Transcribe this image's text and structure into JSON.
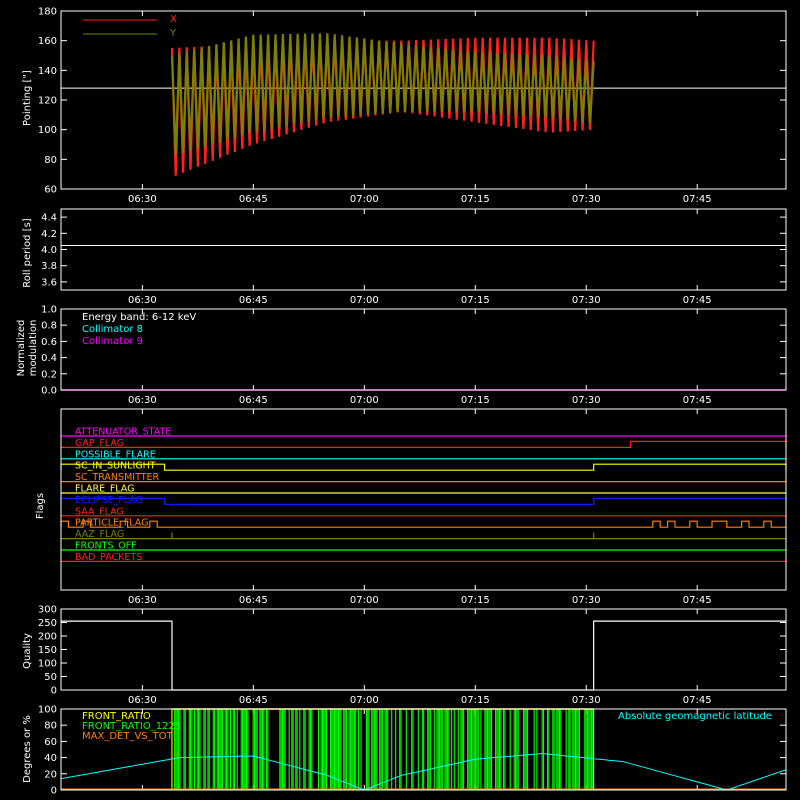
{
  "time_axis": {
    "start": "06:19",
    "end": "07:57",
    "tick_labels": [
      "06:30",
      "06:45",
      "07:00",
      "07:15",
      "07:30",
      "07:45"
    ]
  },
  "chart_data": [
    {
      "type": "line",
      "ylabel": "Pointing [\"]",
      "ylim": [
        60,
        180
      ],
      "yticks": [
        "60",
        "80",
        "100",
        "120",
        "140",
        "160",
        "180"
      ],
      "reference_line": 128,
      "series": [
        {
          "name": "X",
          "color": "#ff2020",
          "t": [
            "06:34",
            "06:45",
            "06:55",
            "07:05",
            "07:15",
            "07:25",
            "07:31"
          ],
          "high": [
            155,
            158,
            160,
            160,
            162,
            162,
            160
          ],
          "low": [
            68,
            90,
            105,
            112,
            105,
            98,
            100
          ]
        },
        {
          "name": "Y",
          "color": "#808000",
          "t": [
            "06:34",
            "06:45",
            "06:55",
            "07:05",
            "07:15",
            "07:25",
            "07:31"
          ],
          "high": [
            150,
            164,
            165,
            158,
            152,
            150,
            146
          ],
          "low": [
            82,
            98,
            108,
            112,
            112,
            108,
            104
          ]
        }
      ]
    },
    {
      "type": "line",
      "ylabel": "Roll period [s]",
      "ylim": [
        3.5,
        4.5
      ],
      "yticks": [
        "3.6",
        "3.8",
        "4.0",
        "4.2",
        "4.4"
      ],
      "series": [
        {
          "name": "",
          "color": "#ffffff",
          "value": 4.05
        }
      ]
    },
    {
      "type": "line",
      "ylabel": "Normalized modulation",
      "ylim": [
        0,
        1
      ],
      "yticks": [
        "0.0",
        "0.2",
        "0.4",
        "0.6",
        "0.8",
        "1.0"
      ],
      "annotations": [
        {
          "text": "Energy band: 6-12 keV",
          "color": "#ffffff"
        },
        {
          "text": "Collimator 8",
          "color": "#00ffff"
        },
        {
          "text": "Collimator 9",
          "color": "#ff00ff"
        }
      ],
      "series": [
        {
          "name": "Collimator 9",
          "color": "#ff00ff",
          "value": 0.0
        }
      ]
    },
    {
      "type": "line",
      "ylabel": "Flags",
      "flags": [
        {
          "name": "ATTENUATOR_STATE",
          "color": "#ff00ff",
          "segments": []
        },
        {
          "name": "GAP_FLAG",
          "color": "#ff2020",
          "segments": [
            [
              "07:36",
              "07:57"
            ]
          ]
        },
        {
          "name": "POSSIBLE_FLARE",
          "color": "#00ffff",
          "segments": []
        },
        {
          "name": "SC_IN_SUNLIGHT",
          "color": "#ffff00",
          "segments": [
            [
              "06:19",
              "06:33"
            ],
            [
              "07:31",
              "07:57"
            ]
          ]
        },
        {
          "name": "SC_TRANSMITTER",
          "color": "#ff8000",
          "segments": []
        },
        {
          "name": "FLARE_FLAG",
          "color": "#ffff40",
          "segments": []
        },
        {
          "name": "ECLIPSE_FLAG",
          "color": "#0020ff",
          "segments": [
            [
              "06:19",
              "06:33"
            ],
            [
              "07:31",
              "07:57"
            ]
          ]
        },
        {
          "name": "SAA_FLAG",
          "color": "#ff2020",
          "segments": []
        },
        {
          "name": "PARTICLE_FLAG",
          "color": "#ff8000",
          "segments": [
            [
              "06:19",
              "06:20"
            ],
            [
              "06:22",
              "06:23"
            ],
            [
              "06:27",
              "06:28"
            ],
            [
              "06:31",
              "06:32"
            ],
            [
              "07:39",
              "07:40"
            ],
            [
              "07:41",
              "07:42"
            ],
            [
              "07:44",
              "07:45"
            ],
            [
              "07:47",
              "07:49"
            ],
            [
              "07:51",
              "07:52"
            ],
            [
              "07:54",
              "07:55"
            ]
          ]
        },
        {
          "name": "AAZ_FLAG",
          "color": "#808000",
          "segments": [
            [
              "06:34",
              "06:34"
            ],
            [
              "07:31",
              "07:31"
            ]
          ]
        },
        {
          "name": "FRONTS_OFF",
          "color": "#00ff00",
          "segments": []
        },
        {
          "name": "BAD_PACKETS",
          "color": "#ff2020",
          "segments": []
        }
      ]
    },
    {
      "type": "line",
      "ylabel": "Quality",
      "ylim": [
        0,
        300
      ],
      "yticks": [
        "0",
        "50",
        "100",
        "150",
        "200",
        "250",
        "300"
      ],
      "series": [
        {
          "name": "",
          "color": "#ffffff",
          "value_high": 255,
          "value_low": 0,
          "high_segments": [
            [
              "06:19",
              "06:34"
            ],
            [
              "07:31",
              "07:57"
            ]
          ]
        }
      ]
    },
    {
      "type": "line",
      "ylabel": "Degrees or %",
      "ylim": [
        0,
        100
      ],
      "yticks": [
        "0",
        "20",
        "40",
        "60",
        "80",
        "100"
      ],
      "legend": [
        {
          "text": "FRONT_RATIO",
          "color": "#ffff00"
        },
        {
          "text": "FRONT_RATIO_1225",
          "color": "#00ff00"
        },
        {
          "text": "MAX_DET_VS_TOT",
          "color": "#ff8000"
        },
        {
          "text": "Absolute geomagnetic latitude",
          "color": "#00ffff"
        }
      ],
      "latitude": {
        "t": [
          "06:19",
          "06:35",
          "06:45",
          "06:55",
          "07:00",
          "07:05",
          "07:15",
          "07:24",
          "07:35",
          "07:45",
          "07:49",
          "07:57"
        ],
        "values": [
          14,
          40,
          42,
          18,
          0,
          18,
          38,
          45,
          35,
          10,
          0,
          25
        ]
      },
      "green_band": [
        "06:34",
        "07:31"
      ]
    }
  ]
}
